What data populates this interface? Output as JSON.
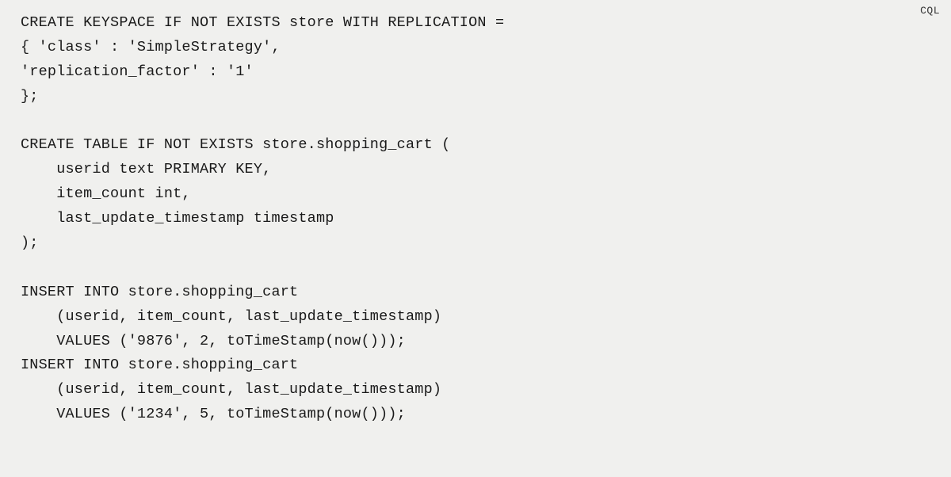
{
  "codeBlock": {
    "language": "CQL",
    "lines": [
      "CREATE KEYSPACE IF NOT EXISTS store WITH REPLICATION =",
      "{ 'class' : 'SimpleStrategy',",
      "'replication_factor' : '1'",
      "};",
      "",
      "CREATE TABLE IF NOT EXISTS store.shopping_cart (",
      "    userid text PRIMARY KEY,",
      "    item_count int,",
      "    last_update_timestamp timestamp",
      ");",
      "",
      "INSERT INTO store.shopping_cart",
      "    (userid, item_count, last_update_timestamp)",
      "    VALUES ('9876', 2, toTimeStamp(now()));",
      "INSERT INTO store.shopping_cart",
      "    (userid, item_count, last_update_timestamp)",
      "    VALUES ('1234', 5, toTimeStamp(now()));"
    ]
  }
}
